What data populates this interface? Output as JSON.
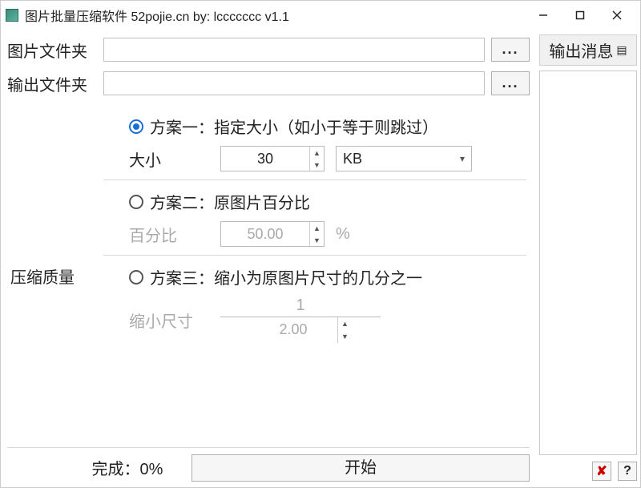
{
  "window": {
    "title": "图片批量压缩软件  52pojie.cn   by: lccccccc     v1.1"
  },
  "inputs": {
    "image_folder_label": "图片文件夹",
    "image_folder_value": "",
    "output_folder_label": "输出文件夹",
    "output_folder_value": "",
    "browse_label": "..."
  },
  "quality_label": "压缩质量",
  "scheme1": {
    "radio_label": "方案一：指定大小（如小于等于则跳过）",
    "size_label": "大小",
    "size_value": "30",
    "unit_selected": "KB"
  },
  "scheme2": {
    "radio_label": "方案二：原图片百分比",
    "percent_label": "百分比",
    "percent_value": "50.00",
    "percent_unit": "%"
  },
  "scheme3": {
    "radio_label": "方案三：缩小为原图片尺寸的几分之一",
    "shrink_label": "缩小尺寸",
    "numerator": "1",
    "denominator": "2.00"
  },
  "footer": {
    "progress_label": "完成：0%",
    "start_label": "开始"
  },
  "side": {
    "header": "输出消息",
    "close_glyph": "✘",
    "help_glyph": "?"
  }
}
